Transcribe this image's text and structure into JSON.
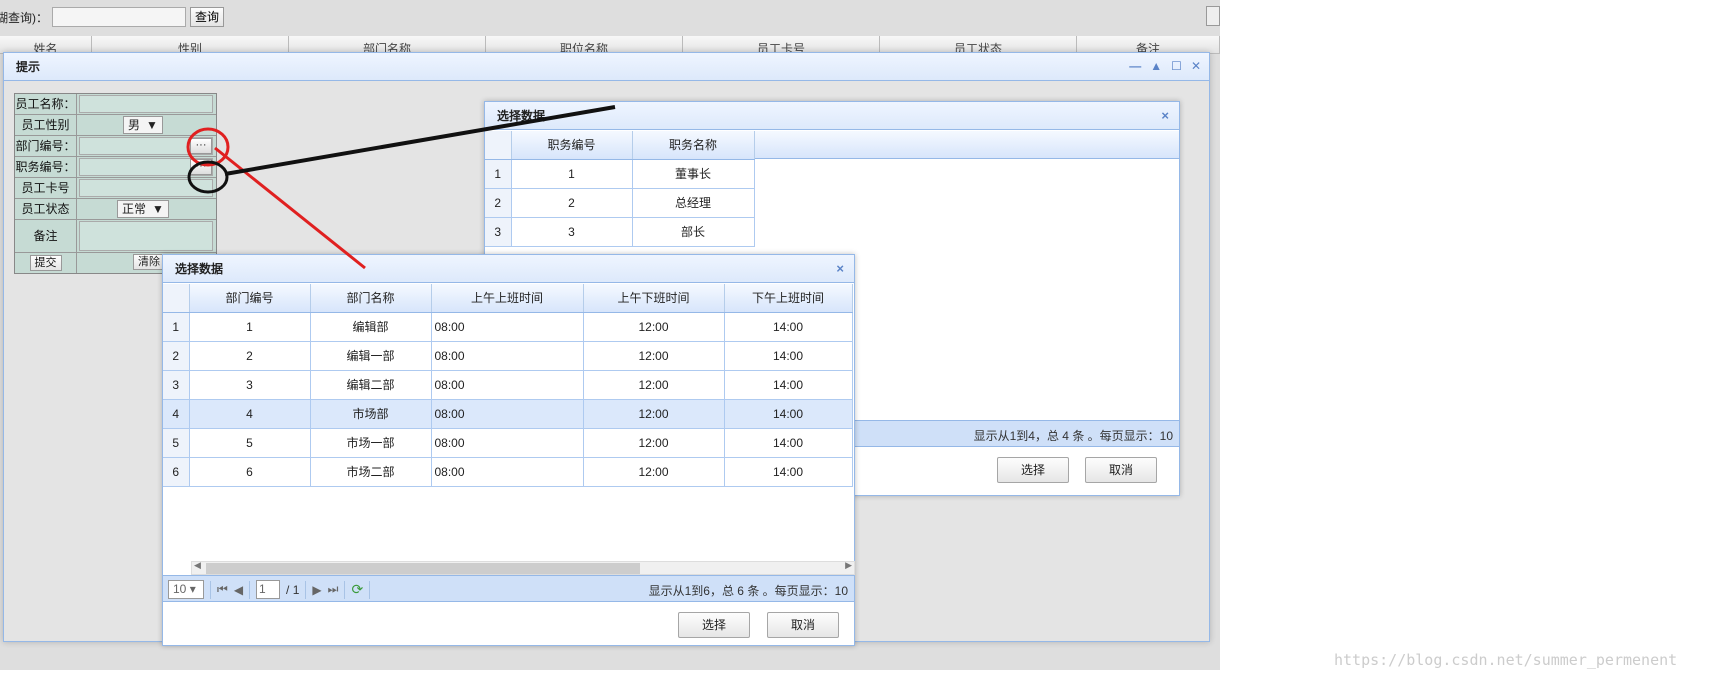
{
  "search": {
    "label": "糊查询)：",
    "button": "查询"
  },
  "bg_grid": {
    "columns": [
      "姓名",
      "性别",
      "部门名称",
      "职位名称",
      "员工卡号",
      "员工状态",
      "备注"
    ]
  },
  "dialog": {
    "title": "提示",
    "tools": [
      "min-icon",
      "collapse-icon",
      "max-icon",
      "close-icon"
    ],
    "form": {
      "name_label": "员工名称：",
      "gender_label": "员工性别",
      "gender_value": "男",
      "dept_label": "部门编号：",
      "job_label": "职务编号：",
      "card_label": "员工卡号",
      "status_label": "员工状态",
      "status_value": "正常",
      "remark_label": "备注",
      "submit": "提交",
      "clear": "清除",
      "ellipsis": "···"
    }
  },
  "job_popup": {
    "title": "选择数据",
    "close": "×",
    "columns": [
      "职务编号",
      "职务名称"
    ],
    "rows": [
      {
        "n": "1",
        "id": "1",
        "name": "董事长"
      },
      {
        "n": "2",
        "id": "2",
        "name": "总经理"
      },
      {
        "n": "3",
        "id": "3",
        "name": "部长"
      }
    ],
    "pager_info": "显示从1到4，总 4 条 。每页显示：10",
    "select": "选择",
    "cancel": "取消"
  },
  "dept_popup": {
    "title": "选择数据",
    "close": "×",
    "columns": [
      "部门编号",
      "部门名称",
      "上午上班时间",
      "上午下班时间",
      "下午上班时间"
    ],
    "rows": [
      {
        "n": "1",
        "id": "1",
        "name": "编辑部",
        "am_in": "08:00",
        "am_out": "12:00",
        "pm_in": "14:00"
      },
      {
        "n": "2",
        "id": "2",
        "name": "编辑一部",
        "am_in": "08:00",
        "am_out": "12:00",
        "pm_in": "14:00"
      },
      {
        "n": "3",
        "id": "3",
        "name": "编辑二部",
        "am_in": "08:00",
        "am_out": "12:00",
        "pm_in": "14:00"
      },
      {
        "n": "4",
        "id": "4",
        "name": "市场部",
        "am_in": "08:00",
        "am_out": "12:00",
        "pm_in": "14:00"
      },
      {
        "n": "5",
        "id": "5",
        "name": "市场一部",
        "am_in": "08:00",
        "am_out": "12:00",
        "pm_in": "14:00"
      },
      {
        "n": "6",
        "id": "6",
        "name": "市场二部",
        "am_in": "08:00",
        "am_out": "12:00",
        "pm_in": "14:00"
      }
    ],
    "page_size": "10",
    "page_num": "1",
    "page_total": "/ 1",
    "pager_info": "显示从1到6，总 6 条 。每页显示：10",
    "select": "选择",
    "cancel": "取消"
  },
  "annotations": {
    "red": "#e02020",
    "black": "#111111"
  },
  "watermark": "https://blog.csdn.net/summer_permenent"
}
